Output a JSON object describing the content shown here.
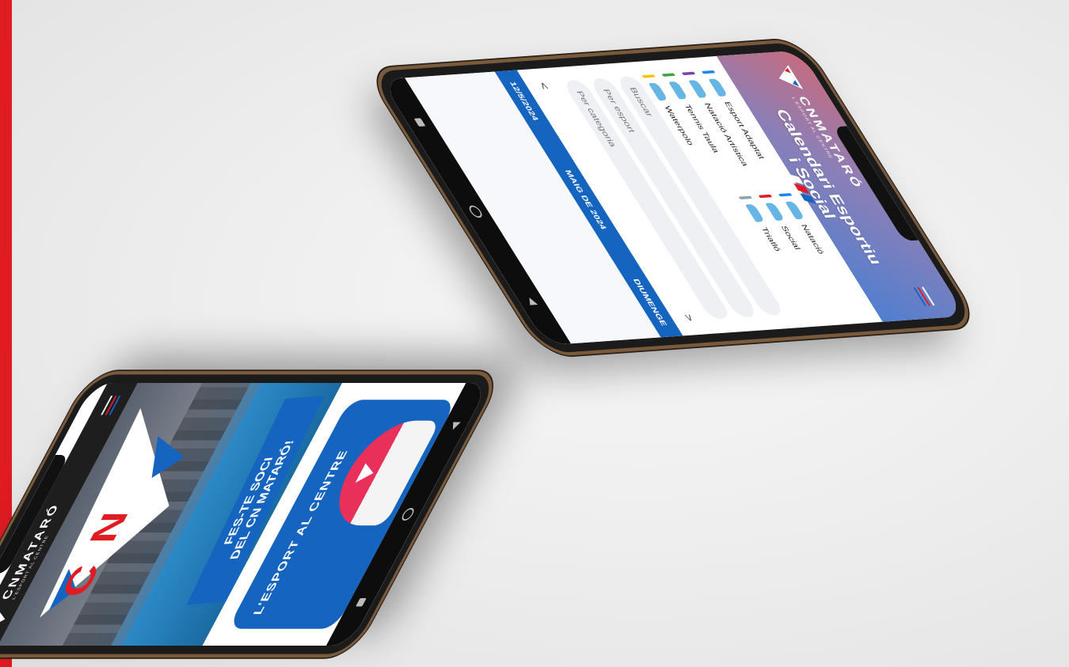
{
  "brand": {
    "name": "CNMATARÓ",
    "tagline": "L'ESPORT AL CENTRE",
    "accent": "#e01b22",
    "primary": "#1565c0"
  },
  "calendar_screen": {
    "title_line1": "Calendari Esportiu",
    "title_line2": "i Social",
    "legend": [
      {
        "label": "Esport Adaptat",
        "color": "#1e88e5",
        "icon": "adaptive-swim-icon"
      },
      {
        "label": "Natació",
        "color": "#1e88e5",
        "icon": "swimming-icon"
      },
      {
        "label": "Natació Artística",
        "color": "#7b3fb0",
        "icon": "artistic-swim-icon"
      },
      {
        "label": "Social",
        "color": "#e01b22",
        "icon": "social-icon"
      },
      {
        "label": "Tennis Taula",
        "color": "#43a047",
        "icon": "table-tennis-icon"
      },
      {
        "label": "Triatló",
        "color": "#90a4ae",
        "icon": "triathlon-icon"
      },
      {
        "label": "Waterpolo",
        "color": "#f9c200",
        "icon": "waterpolo-icon"
      }
    ],
    "filters": {
      "search_placeholder": "Buscar",
      "sport_placeholder": "Per esport",
      "category_placeholder": "Per categoria"
    },
    "nav": {
      "prev": "<",
      "next": ">"
    },
    "date_bar": {
      "date": "12/5/2024",
      "month": "MAIG DE 2024",
      "weekday": "DIUMENGE"
    }
  },
  "home_screen": {
    "cta_line1": "FES-TE SOCI",
    "cta_line2": "DEL CN MATARÓ!",
    "section_label": "L'ESPORT AL CENTRE"
  }
}
